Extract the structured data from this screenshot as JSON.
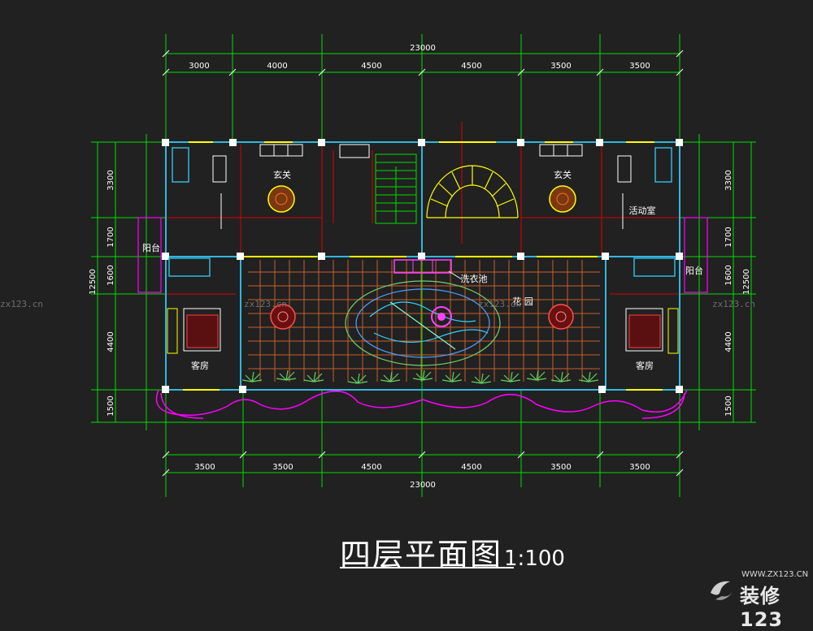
{
  "drawing": {
    "title": "四层平面图",
    "scale": "1:100",
    "total_width": "23000",
    "top_dimensions": [
      "3000",
      "4000",
      "4500",
      "4500",
      "3500",
      "3500"
    ],
    "bottom_dimensions": [
      "3500",
      "3500",
      "4500",
      "4500",
      "3500",
      "3500"
    ],
    "total_depth": "12500",
    "side_dimensions": [
      "3300",
      "1700",
      "1600",
      "4400",
      "1500"
    ]
  },
  "rooms": {
    "foyer_left": "玄关",
    "foyer_right": "玄关",
    "activity_room": "活动室",
    "balcony_left": "阳台",
    "balcony_right": "阳台",
    "guest_room_left": "客房",
    "guest_room_right": "客房",
    "laundry_basin": "洗衣池",
    "garden": "花    园"
  },
  "watermark": {
    "site": "zx123.cn",
    "url": "WWW.ZX123.CN",
    "brand": "装修123"
  },
  "colors": {
    "background": "#212121",
    "axis": "#00e000",
    "wall": "#2fb8e0",
    "partition": "#e00000",
    "window": "#ffff00",
    "landscape": "#ff00ff",
    "text": "#ffffff"
  }
}
